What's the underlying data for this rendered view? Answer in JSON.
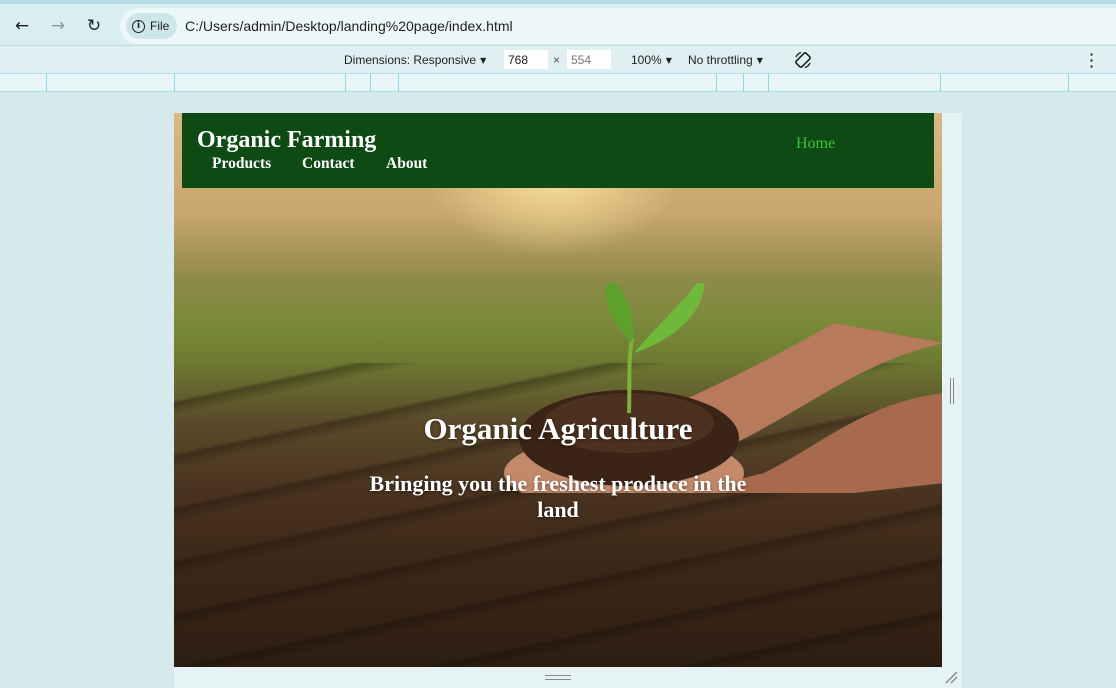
{
  "browser": {
    "back_icon": "arrow-left-icon",
    "forward_icon": "arrow-right-icon",
    "reload_icon": "reload-icon",
    "scheme_chip_label": "File",
    "url": "C:/Users/admin/Desktop/landing%20page/index.html"
  },
  "device_toolbar": {
    "dimensions_label": "Dimensions: Responsive",
    "width_value": "768",
    "height_placeholder": "554",
    "times_symbol": "×",
    "zoom_label": "100%",
    "throttling_label": "No throttling",
    "more_icon": "more-vert-icon",
    "rotate_icon": "rotate-icon"
  },
  "site": {
    "title": "Organic Farming",
    "nav": {
      "home": "Home",
      "products": "Products",
      "contact": "Contact",
      "about": "About"
    },
    "hero": {
      "title": "Organic Agriculture",
      "subtitle": "Bringing you the freshest produce in the land"
    }
  }
}
